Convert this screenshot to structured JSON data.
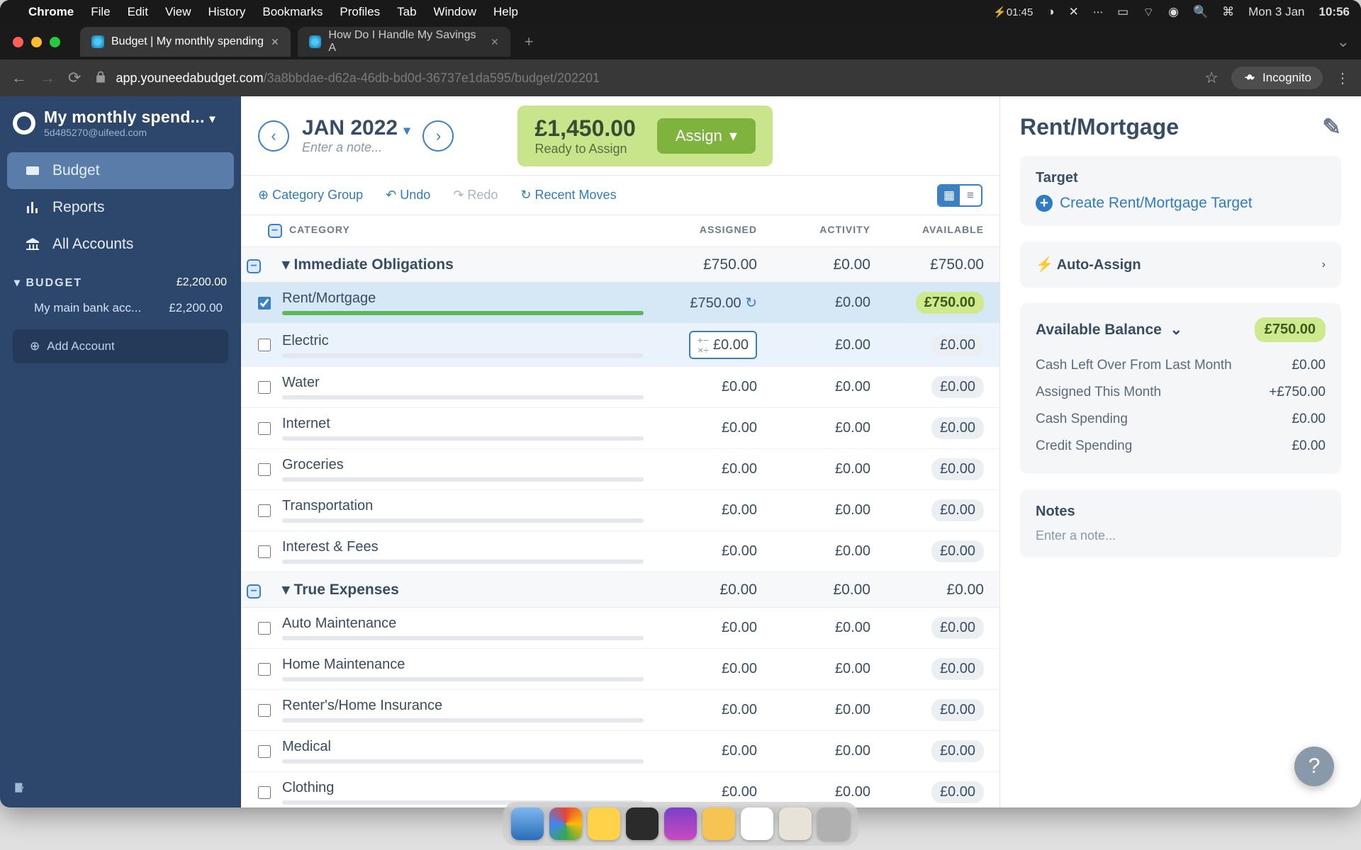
{
  "mac_menu": {
    "items": [
      "Chrome",
      "File",
      "Edit",
      "View",
      "History",
      "Bookmarks",
      "Profiles",
      "Tab",
      "Window",
      "Help"
    ],
    "battery": "01:45",
    "date": "Mon 3 Jan",
    "time": "10:56"
  },
  "tabs": [
    {
      "title": "Budget | My monthly spending",
      "active": true
    },
    {
      "title": "How Do I Handle My Savings A",
      "active": false
    }
  ],
  "url": {
    "host": "app.youneedabudget.com",
    "path": "/3a8bbdae-d62a-46db-bd0d-36737e1da595/budget/202201",
    "incognito": "Incognito"
  },
  "sidebar": {
    "budget_name": "My monthly spend...",
    "email": "5d485270@uifeed.com",
    "nav": [
      "Budget",
      "Reports",
      "All Accounts"
    ],
    "section": "BUDGET",
    "section_total": "£2,200.00",
    "account_name": "My main bank acc...",
    "account_balance": "£2,200.00",
    "add_account": "Add Account"
  },
  "topbar": {
    "month": "JAN 2022",
    "note_placeholder": "Enter a note...",
    "ready_amount": "£1,450.00",
    "ready_label": "Ready to Assign",
    "assign_btn": "Assign"
  },
  "toolbar": {
    "add_group": "Category Group",
    "undo": "Undo",
    "redo": "Redo",
    "recent": "Recent Moves"
  },
  "headers": {
    "category": "CATEGORY",
    "assigned": "ASSIGNED",
    "activity": "ACTIVITY",
    "available": "AVAILABLE"
  },
  "groups": [
    {
      "name": "Immediate Obligations",
      "assigned": "£750.00",
      "activity": "£0.00",
      "available": "£750.00",
      "rows": [
        {
          "name": "Rent/Mortgage",
          "assigned": "£750.00",
          "activity": "£0.00",
          "available": "£750.00",
          "selected": true,
          "green": true
        },
        {
          "name": "Electric",
          "assigned": "£0.00",
          "activity": "£0.00",
          "available": "£0.00",
          "editing": true
        },
        {
          "name": "Water",
          "assigned": "£0.00",
          "activity": "£0.00",
          "available": "£0.00"
        },
        {
          "name": "Internet",
          "assigned": "£0.00",
          "activity": "£0.00",
          "available": "£0.00"
        },
        {
          "name": "Groceries",
          "assigned": "£0.00",
          "activity": "£0.00",
          "available": "£0.00"
        },
        {
          "name": "Transportation",
          "assigned": "£0.00",
          "activity": "£0.00",
          "available": "£0.00"
        },
        {
          "name": "Interest & Fees",
          "assigned": "£0.00",
          "activity": "£0.00",
          "available": "£0.00"
        }
      ]
    },
    {
      "name": "True Expenses",
      "assigned": "£0.00",
      "activity": "£0.00",
      "available": "£0.00",
      "rows": [
        {
          "name": "Auto Maintenance",
          "assigned": "£0.00",
          "activity": "£0.00",
          "available": "£0.00"
        },
        {
          "name": "Home Maintenance",
          "assigned": "£0.00",
          "activity": "£0.00",
          "available": "£0.00"
        },
        {
          "name": "Renter's/Home Insurance",
          "assigned": "£0.00",
          "activity": "£0.00",
          "available": "£0.00"
        },
        {
          "name": "Medical",
          "assigned": "£0.00",
          "activity": "£0.00",
          "available": "£0.00"
        },
        {
          "name": "Clothing",
          "assigned": "£0.00",
          "activity": "£0.00",
          "available": "£0.00"
        }
      ]
    }
  ],
  "inspector": {
    "title": "Rent/Mortgage",
    "target_label": "Target",
    "create_target": "Create Rent/Mortgage Target",
    "auto_assign": "Auto-Assign",
    "avail_label": "Available Balance",
    "avail_value": "£750.00",
    "breakdown": [
      {
        "k": "Cash Left Over From Last Month",
        "v": "£0.00"
      },
      {
        "k": "Assigned This Month",
        "v": "+£750.00"
      },
      {
        "k": "Cash Spending",
        "v": "£0.00"
      },
      {
        "k": "Credit Spending",
        "v": "£0.00"
      }
    ],
    "notes_label": "Notes",
    "notes_placeholder": "Enter a note..."
  }
}
